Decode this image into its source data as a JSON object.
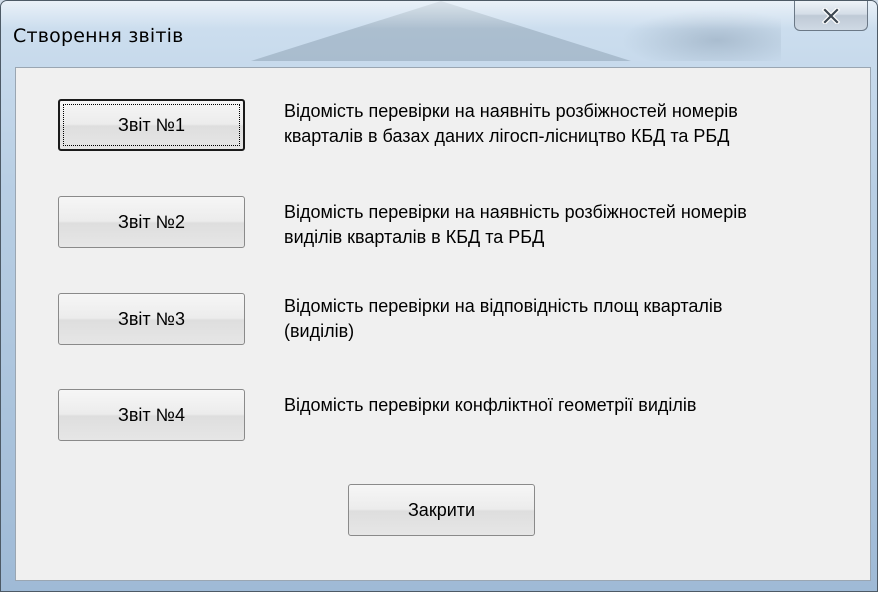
{
  "window": {
    "title": "Створення звітів",
    "close_icon": "close-icon"
  },
  "reports": [
    {
      "button_label": "Звіт №1",
      "description_lines": [
        "Відомість перевірки на наявніть розбіжностей номерів",
        "кварталів в базах даних лігосп-лісництво КБД та РБД"
      ]
    },
    {
      "button_label": "Звіт №2",
      "description_lines": [
        "Відомість перевірки на наявність розбіжностей номерів",
        "виділів кварталів в КБД та РБД"
      ]
    },
    {
      "button_label": "Звіт №3",
      "description_lines": [
        "Відомість перевірки на відповідність площ кварталів",
        "(виділів)"
      ]
    },
    {
      "button_label": "Звіт №4",
      "description_lines": [
        "Відомість перевірки конфліктної геометрії виділів"
      ]
    }
  ],
  "footer": {
    "close_label": "Закрити"
  }
}
